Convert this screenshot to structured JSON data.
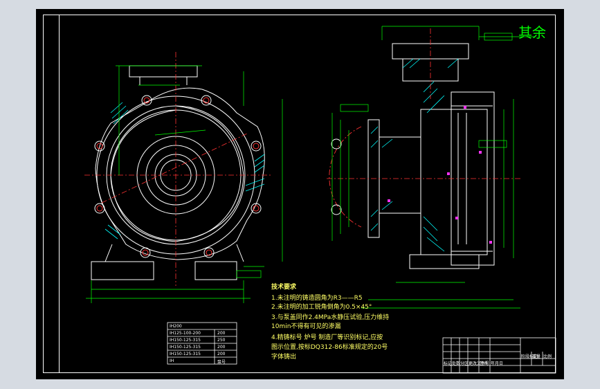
{
  "roughness_label": "其余",
  "notes": {
    "title": "技术要求",
    "items": [
      "1.未注明的铸造圆角为R3——R5",
      "2.未注明的加工锐角倒角为0.5×45°",
      "3.与泵盖同作2.4MPa水静压试验,压力维持",
      "  10min不得有可见的渗漏",
      "4.精铸标号 炉号 制造厂等识别标记,应按",
      "  图示位置,按标DQ312-86标准规定的20号",
      "  字体铸出"
    ]
  },
  "part_table": {
    "rows": [
      [
        "IH200",
        ""
      ],
      [
        "IH125-100-200",
        "200"
      ],
      [
        "IH150-125-315",
        "250"
      ],
      [
        "IH150-125-315",
        "200"
      ],
      [
        "IH150-125-315",
        "200"
      ],
      [
        "IH",
        "泵号"
      ]
    ]
  },
  "title_block": {
    "labels": [
      "标记",
      "处数",
      "分区",
      "更改文件号",
      "签名",
      "年月日",
      "阶段标记",
      "重量",
      "比例"
    ]
  },
  "colors": {
    "background": "#000000",
    "outline": "#ffffff",
    "dimension": "#00ff00",
    "centerline": "#ff3333",
    "hatch": "#00ffff",
    "note": "#ffff66",
    "accent": "#ff33ff"
  }
}
